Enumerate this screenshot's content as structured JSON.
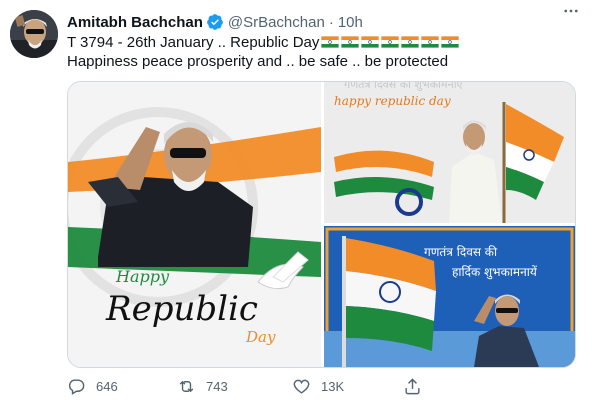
{
  "tweet": {
    "author_name": "Amitabh Bachchan",
    "handle": "@SrBachchan",
    "separator": "·",
    "time": "10h",
    "line1": "T 3794 - 26th January .. Republic Day",
    "line2": "Happiness peace prosperity and .. be safe .. be protected",
    "flag_emoji_count": 7
  },
  "media": {
    "image1": {
      "script_line1": "Happy",
      "script_line2": "Republic",
      "script_line3": "Day"
    },
    "image2": {
      "hindi_faded": "गणतंत्र दिवस की शुभकामनाएं",
      "caption": "happy republic day"
    },
    "image3": {
      "hindi_line1": "गणतंत्र दिवस  की",
      "hindi_line2": "हार्दिक शुभकामनायें"
    }
  },
  "actions": {
    "replies": "646",
    "retweets": "743",
    "likes": "13K"
  },
  "colors": {
    "saffron": "#f28c28",
    "green": "#1e8a3e",
    "chakra": "#1a3a8c",
    "verified": "#1d9bf0",
    "muted": "#536471"
  }
}
